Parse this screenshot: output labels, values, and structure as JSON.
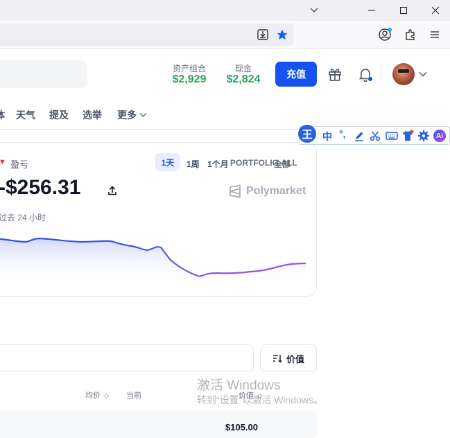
{
  "browser": {
    "window_controls": [
      "minimize",
      "maximize",
      "close"
    ],
    "toolbar_icons": [
      "download-icon",
      "star-icon",
      "account-icon",
      "extensions-icon",
      "menu-icon"
    ]
  },
  "header": {
    "portfolio_label": "资产组合",
    "portfolio_value": "$2,929",
    "cash_label": "现金",
    "cash_value": "$2,824",
    "deposit_label": "充值"
  },
  "nav": {
    "items": [
      "体",
      "天气",
      "提及",
      "选举",
      "更多"
    ]
  },
  "ime": {
    "logo": "王",
    "mode": "中",
    "punct": "°,"
  },
  "pnl": {
    "label": "盈亏",
    "value": "-$256.31",
    "period_text": "过去 24 小时",
    "brand": "Polymarket",
    "ranges": [
      "1天",
      "1周",
      "1个月",
      "PORTFOLIO.ALL"
    ],
    "ranges_overlap": "全部"
  },
  "positions": {
    "sort_label": "价值",
    "columns": [
      "均价",
      "当前",
      "价值"
    ],
    "first_row_value": "$105.00"
  },
  "watermark": {
    "line1": "激活 Windows",
    "line2": "转到“设置”以激活 Windows。"
  },
  "colors": {
    "accent": "#1652f0",
    "positive": "#27a55f",
    "line_start": "#2b50e0",
    "line_end": "#9b55e0"
  }
}
